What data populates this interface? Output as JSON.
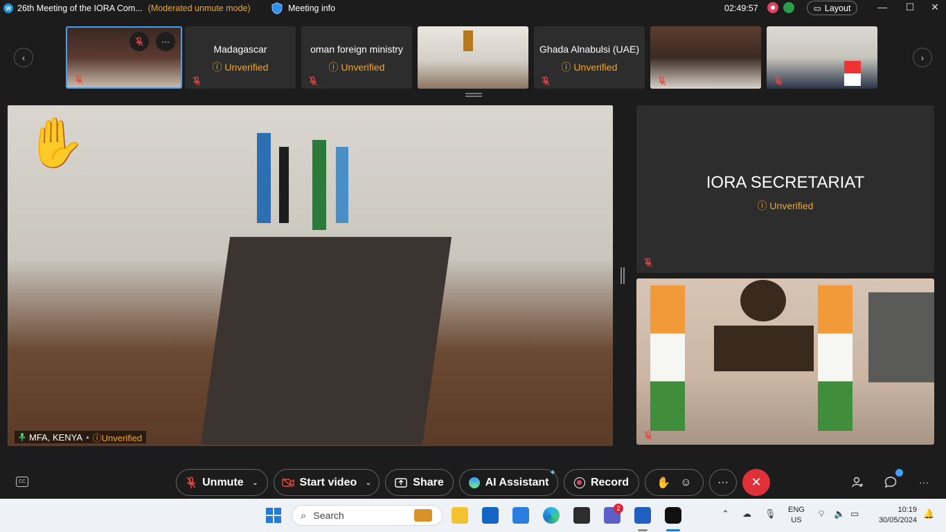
{
  "titlebar": {
    "title": "26th Meeting of the IORA Com...",
    "mode": "(Moderated unmute mode)",
    "meeting_info": "Meeting info",
    "time": "02:49:57",
    "layout_label": "Layout",
    "minimize": "—",
    "maximize": "☐",
    "close": "✕"
  },
  "filmstrip": {
    "prev": "‹",
    "next": "›",
    "tiles": [
      {
        "name": "Madagascar",
        "status": "Unverified"
      },
      {
        "name": "oman foreign ministry",
        "status": "Unverified"
      },
      {
        "name": "Ghada Alnabulsi (UAE)",
        "status": "Unverified"
      }
    ]
  },
  "main": {
    "participant": "MFA, KENYA",
    "status": "Unverified",
    "hand": "✋"
  },
  "right_tile": {
    "name": "IORA SECRETARIAT",
    "status": "Unverified"
  },
  "controls": {
    "unmute": "Unmute",
    "start_video": "Start video",
    "share": "Share",
    "ai_assistant": "AI Assistant",
    "record": "Record",
    "more": "···",
    "end": "✕"
  },
  "taskbar": {
    "search_placeholder": "Search",
    "teams_badge": "2",
    "lang_top": "ENG",
    "lang_bottom": "US",
    "clock_time": "10:19",
    "clock_date": "30/05/2024"
  },
  "colors": {
    "accent": "#3ea1ff",
    "warning": "#f5a623",
    "end_call": "#e0303a"
  }
}
